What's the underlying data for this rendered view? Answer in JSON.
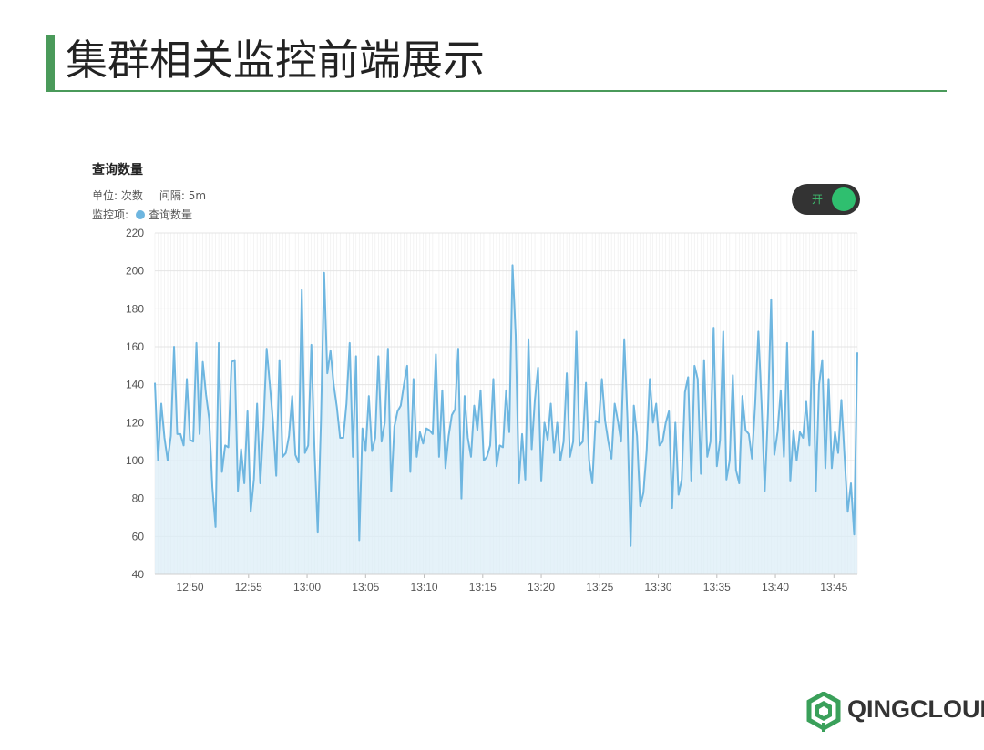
{
  "slide": {
    "title": "集群相关监控前端展示"
  },
  "panel": {
    "chart_title": "查询数量",
    "unit_text": "单位: 次数",
    "interval_text": "间隔: 5m",
    "monitor_label": "监控项:",
    "legend_label": "查询数量",
    "toggle_label": "开"
  },
  "colors": {
    "accent": "#4a9a5a",
    "series_line": "#6eb6e0",
    "series_fill": "#dceef7",
    "toggle_on": "#2fbf6f"
  },
  "logo": {
    "text": "QINGCLOUD"
  },
  "chart_data": {
    "type": "area",
    "x_ticks": [
      "12:50",
      "12:55",
      "13:00",
      "13:05",
      "13:10",
      "13:15",
      "13:20",
      "13:25",
      "13:30",
      "13:35",
      "13:40",
      "13:45"
    ],
    "x_start": "12:47",
    "x_end": "13:47",
    "ylim": [
      40,
      220
    ],
    "yticks": [
      40,
      60,
      80,
      100,
      120,
      140,
      160,
      180,
      200,
      220
    ],
    "grid": true,
    "series": [
      {
        "name": "查询数量",
        "values": [
          141,
          100,
          130,
          112,
          100,
          113,
          160,
          114,
          114,
          108,
          143,
          111,
          110,
          162,
          114,
          152,
          135,
          122,
          86,
          65,
          162,
          94,
          108,
          107,
          152,
          153,
          84,
          106,
          88,
          126,
          73,
          90,
          130,
          88,
          118,
          159,
          140,
          120,
          92,
          153,
          102,
          104,
          113,
          134,
          103,
          99,
          190,
          104,
          108,
          161,
          105,
          62,
          120,
          199,
          146,
          158,
          140,
          128,
          112,
          112,
          130,
          162,
          102,
          155,
          58,
          117,
          105,
          134,
          105,
          112,
          155,
          110,
          120,
          159,
          84,
          118,
          126,
          129,
          140,
          150,
          94,
          143,
          102,
          115,
          109,
          117,
          116,
          114,
          156,
          102,
          137,
          96,
          113,
          124,
          127,
          159,
          80,
          134,
          112,
          102,
          129,
          116,
          137,
          100,
          102,
          108,
          143,
          97,
          108,
          107,
          137,
          115,
          203,
          166,
          88,
          114,
          90,
          164,
          106,
          132,
          149,
          89,
          120,
          111,
          130,
          104,
          120,
          100,
          110,
          146,
          102,
          110,
          168,
          108,
          110,
          141,
          100,
          88,
          121,
          120,
          143,
          121,
          110,
          101,
          130,
          121,
          110,
          164,
          122,
          55,
          129,
          113,
          76,
          83,
          105,
          143,
          120,
          130,
          108,
          110,
          120,
          126,
          75,
          120,
          82,
          90,
          136,
          144,
          89,
          150,
          143,
          93,
          153,
          102,
          110,
          170,
          97,
          111,
          168,
          90,
          100,
          145,
          95,
          88,
          134,
          116,
          114,
          101,
          130,
          168,
          130,
          84,
          125,
          185,
          103,
          115,
          137,
          102,
          162,
          89,
          116,
          100,
          115,
          112,
          131,
          108,
          168,
          84,
          140,
          153,
          96,
          143,
          96,
          115,
          104,
          132,
          102,
          73,
          88,
          61,
          157
        ]
      }
    ]
  }
}
